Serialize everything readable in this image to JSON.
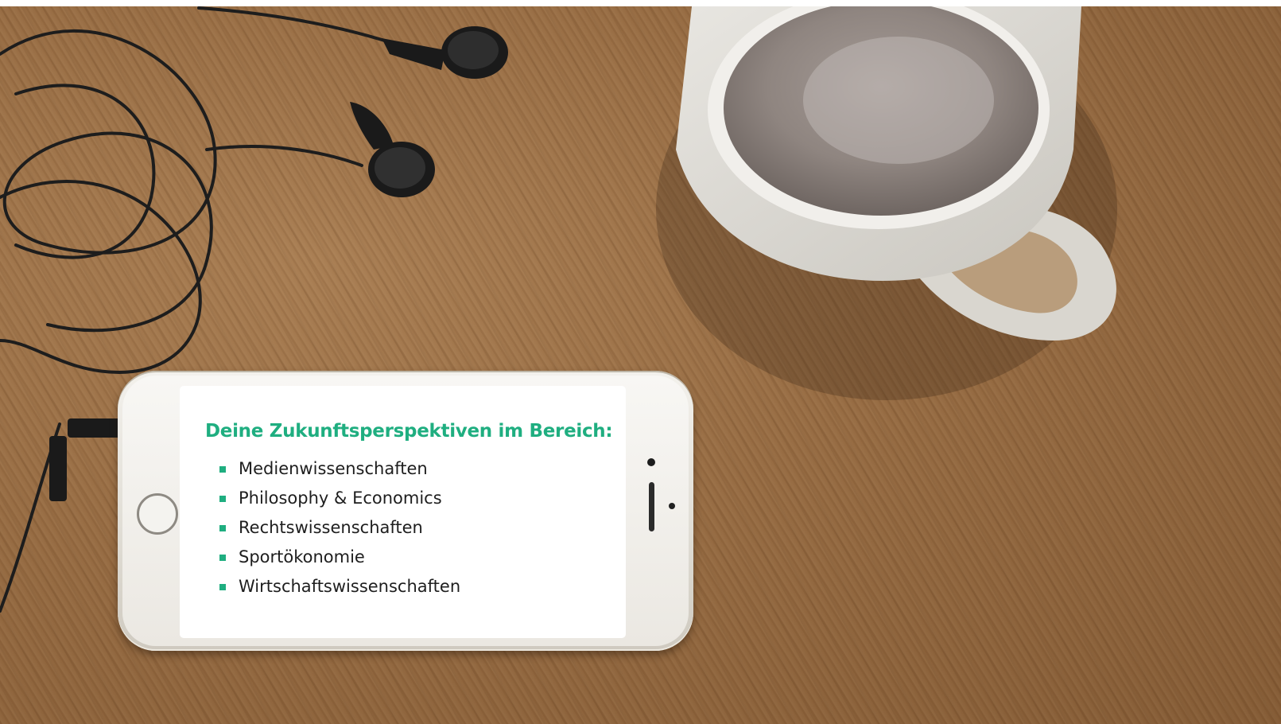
{
  "card": {
    "heading": "Deine Zukunftsperspektiven im Bereich:",
    "items": [
      "Medienwissenschaften",
      "Philosophy & Economics",
      "Rechtswissenschaften",
      "Sportökonomie",
      "Wirtschaftswissenschaften"
    ]
  },
  "colors": {
    "accent": "#1fae80",
    "text": "#1e1e1e",
    "card_background": "#ffffff",
    "table_wood": "#966b42"
  },
  "icons": [
    "earphones-icon",
    "coffee-mug-icon",
    "smartphone-icon",
    "square-bullet-icon"
  ]
}
